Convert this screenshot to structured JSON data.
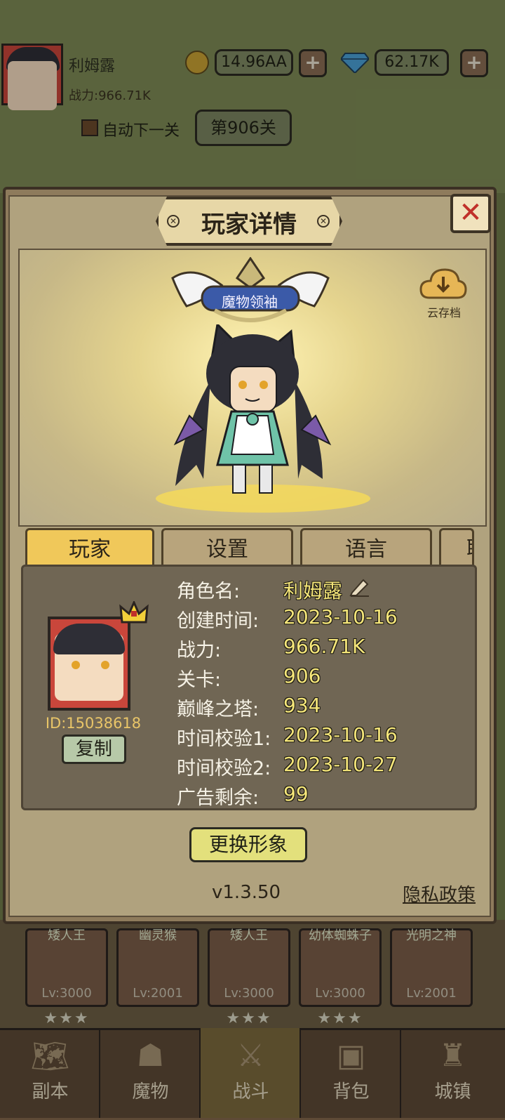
{
  "header": {
    "player_name": "利姆露",
    "power": "战力:966.71K",
    "gold": "14.96AA",
    "gems": "62.17K",
    "plus": "+",
    "auto_next": "自动下一关",
    "level": "第906关"
  },
  "modal": {
    "title": "玩家详情",
    "close": "✕",
    "badge_title": "魔物领袖",
    "cloud_save": "云存档",
    "tabs": [
      "玩家",
      "设置",
      "语言",
      "联"
    ],
    "player_id": "ID:15038618",
    "copy": "复制",
    "info": [
      {
        "label": "角色名:",
        "value": "利姆露"
      },
      {
        "label": "创建时间:",
        "value": "2023-10-16"
      },
      {
        "label": "战力:",
        "value": "966.71K"
      },
      {
        "label": "关卡:",
        "value": "906"
      },
      {
        "label": "巅峰之塔:",
        "value": "934"
      },
      {
        "label": "时间校验1:",
        "value": "2023-10-16"
      },
      {
        "label": "时间校验2:",
        "value": "2023-10-27"
      },
      {
        "label": "广告剩余:",
        "value": "99"
      }
    ],
    "change_avatar": "更换形象",
    "version": "v1.3.50",
    "privacy": "隐私政策"
  },
  "cards": [
    {
      "name": "矮人王",
      "level": "Lv:3000",
      "stars": "★★★"
    },
    {
      "name": "幽灵猴",
      "level": "Lv:2001",
      "stars": ""
    },
    {
      "name": "矮人王",
      "level": "Lv:3000",
      "stars": "★★★"
    },
    {
      "name": "幼体蜘蛛子",
      "level": "Lv:3000",
      "stars": "★★★"
    },
    {
      "name": "光明之神",
      "level": "Lv:2001",
      "stars": ""
    }
  ],
  "nav": [
    {
      "label": "副本",
      "icon": "map-icon"
    },
    {
      "label": "魔物",
      "icon": "monster-icon"
    },
    {
      "label": "战斗",
      "icon": "swords-icon"
    },
    {
      "label": "背包",
      "icon": "backpack-icon"
    },
    {
      "label": "城镇",
      "icon": "castle-icon"
    }
  ],
  "colors": {
    "accent_tab": "#f0c85a",
    "value_text": "#f5e67a",
    "close_red": "#c0302a"
  }
}
